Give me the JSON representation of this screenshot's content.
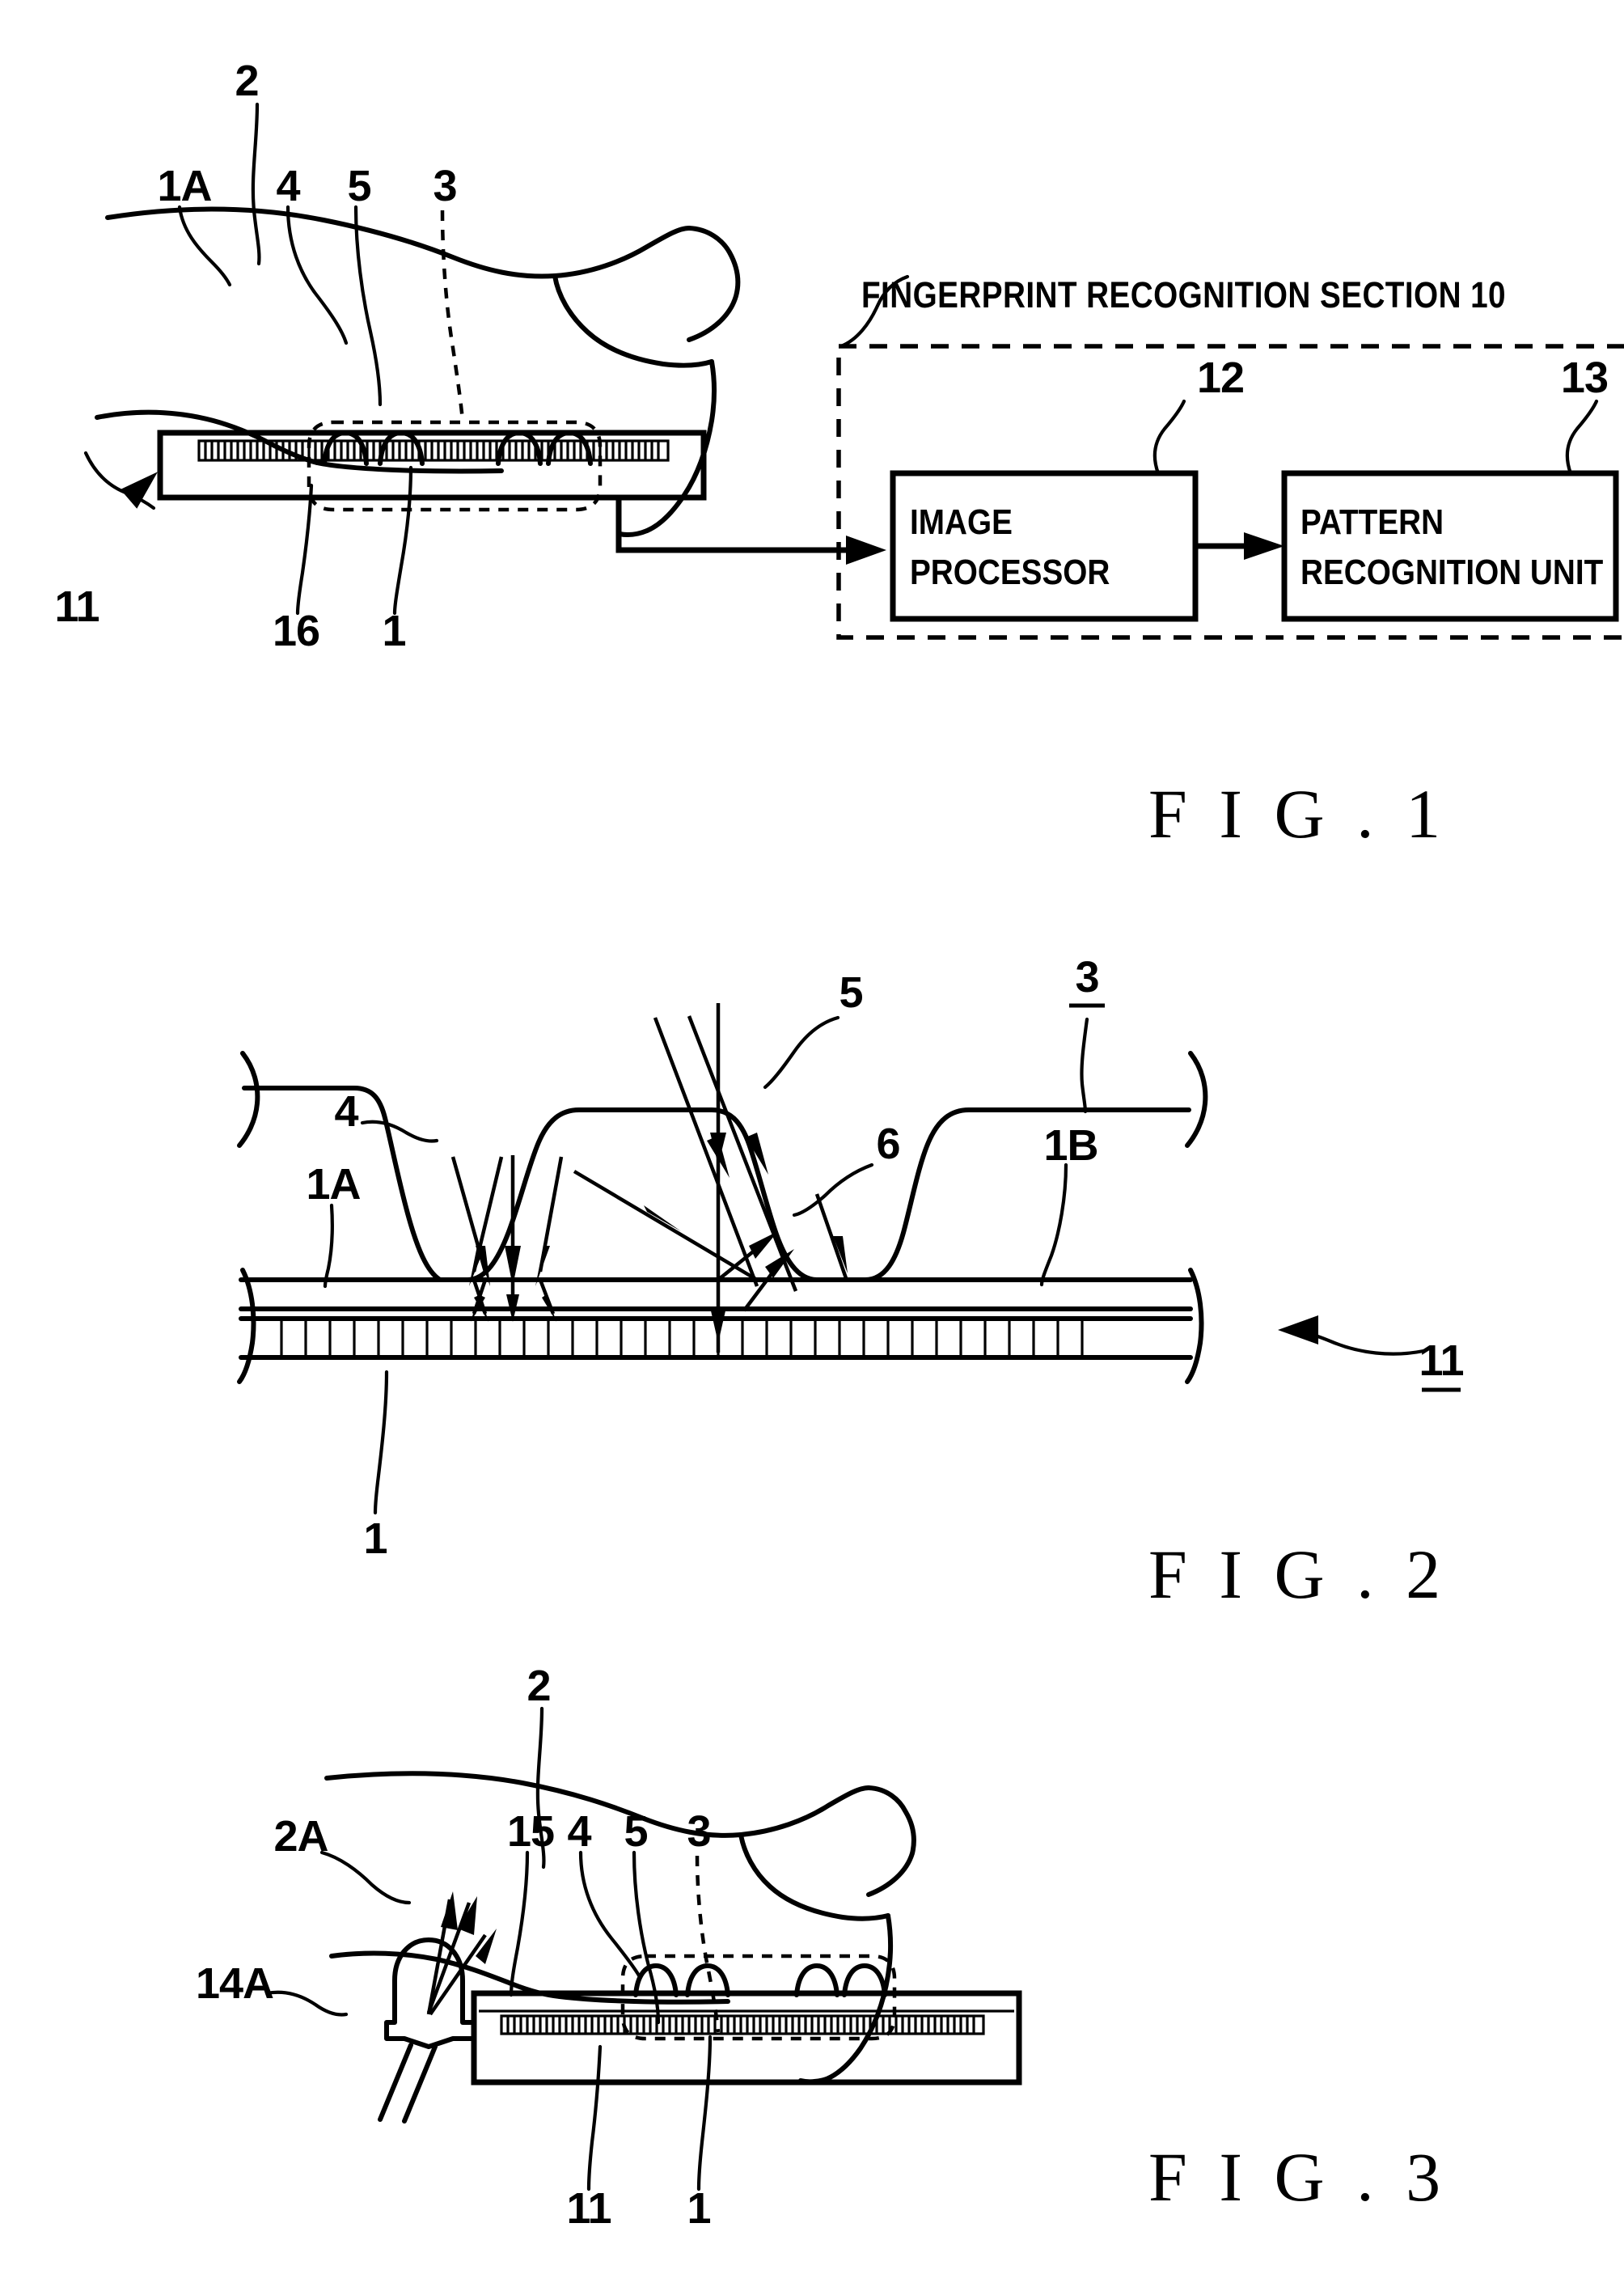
{
  "document": {
    "type": "patent-drawing-sheet",
    "figures": [
      {
        "id": "fig1",
        "caption": "F I G . 1",
        "section_title": "FINGERPRINT RECOGNITION SECTION 10",
        "blocks": [
          {
            "id": "block12",
            "label_line1": "IMAGE",
            "label_line2": "PROCESSOR",
            "ref": "12"
          },
          {
            "id": "block13",
            "label_line1": "PATTERN",
            "label_line2": "RECOGNITION UNIT",
            "ref": "13"
          }
        ],
        "reference_numerals": [
          {
            "ref": "2",
            "underlined": false
          },
          {
            "ref": "1A",
            "underlined": false
          },
          {
            "ref": "4",
            "underlined": false
          },
          {
            "ref": "5",
            "underlined": false
          },
          {
            "ref": "3",
            "underlined": false
          },
          {
            "ref": "11",
            "underlined": false
          },
          {
            "ref": "16",
            "underlined": false
          },
          {
            "ref": "1",
            "underlined": false
          },
          {
            "ref": "12",
            "underlined": false
          },
          {
            "ref": "13",
            "underlined": false
          }
        ]
      },
      {
        "id": "fig2",
        "caption": "F I G . 2",
        "reference_numerals": [
          {
            "ref": "5",
            "underlined": false
          },
          {
            "ref": "3",
            "underlined": true
          },
          {
            "ref": "4",
            "underlined": false
          },
          {
            "ref": "1A",
            "underlined": false
          },
          {
            "ref": "6",
            "underlined": false
          },
          {
            "ref": "1B",
            "underlined": false
          },
          {
            "ref": "11",
            "underlined": true
          },
          {
            "ref": "1",
            "underlined": false
          }
        ]
      },
      {
        "id": "fig3",
        "caption": "F I G . 3",
        "reference_numerals": [
          {
            "ref": "2",
            "underlined": false
          },
          {
            "ref": "2A",
            "underlined": false
          },
          {
            "ref": "15",
            "underlined": false
          },
          {
            "ref": "4",
            "underlined": false
          },
          {
            "ref": "5",
            "underlined": false
          },
          {
            "ref": "3",
            "underlined": false
          },
          {
            "ref": "14A",
            "underlined": false
          },
          {
            "ref": "11",
            "underlined": false
          },
          {
            "ref": "1",
            "underlined": false
          }
        ]
      }
    ]
  },
  "fig1": {
    "caption": "F I G . 1",
    "section_title": "FINGERPRINT RECOGNITION SECTION 10",
    "image_processor_line1": "IMAGE",
    "image_processor_line2": "PROCESSOR",
    "pattern_unit_line1": "PATTERN",
    "pattern_unit_line2": "RECOGNITION UNIT",
    "ref_2": "2",
    "ref_1A": "1A",
    "ref_4": "4",
    "ref_5": "5",
    "ref_3": "3",
    "ref_11": "11",
    "ref_16": "16",
    "ref_1": "1",
    "ref_12": "12",
    "ref_13": "13"
  },
  "fig2": {
    "caption": "F I G . 2",
    "ref_5": "5",
    "ref_3": "3",
    "ref_4": "4",
    "ref_1A": "1A",
    "ref_6": "6",
    "ref_1B": "1B",
    "ref_11": "11",
    "ref_1": "1"
  },
  "fig3": {
    "caption": "F I G . 3",
    "ref_2": "2",
    "ref_2A": "2A",
    "ref_15": "15",
    "ref_4": "4",
    "ref_5": "5",
    "ref_3": "3",
    "ref_14A": "14A",
    "ref_11": "11",
    "ref_1": "1"
  },
  "colors": {
    "ink": "#000000",
    "paper": "#ffffff"
  }
}
